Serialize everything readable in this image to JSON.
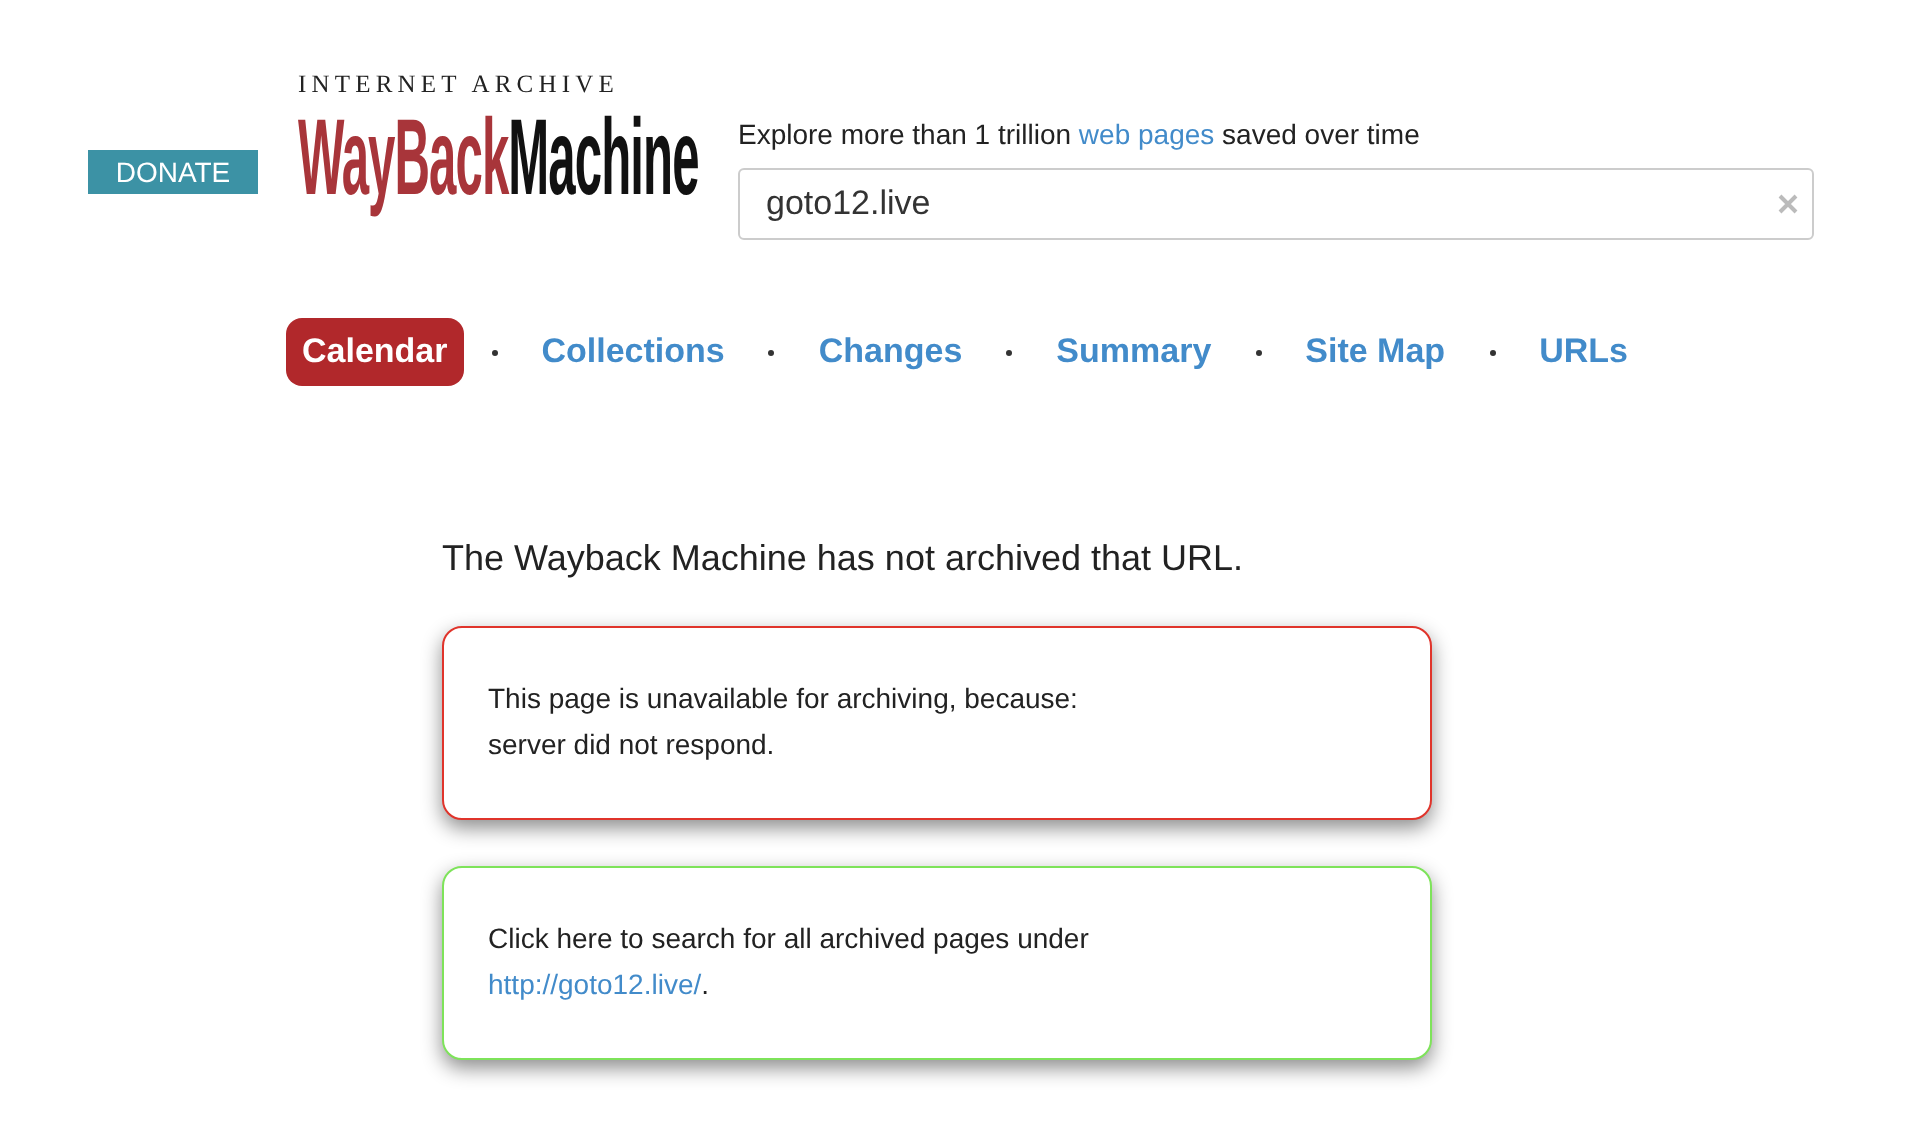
{
  "donate_button": "DONATE",
  "logo": {
    "top": "INTERNET ARCHIVE",
    "part_1": "WayBack",
    "part_2": "Machine"
  },
  "tagline": {
    "before": "Explore more than 1 trillion",
    "link": "web pages",
    "after": "saved over time"
  },
  "search": {
    "value": "goto12.live"
  },
  "tabs": [
    {
      "label": "Calendar",
      "selected": true
    },
    {
      "label": "Collections",
      "selected": false
    },
    {
      "label": "Changes",
      "selected": false
    },
    {
      "label": "Summary",
      "selected": false
    },
    {
      "label": "Site Map",
      "selected": false
    },
    {
      "label": "URLs",
      "selected": false
    }
  ],
  "heading": "The Wayback Machine has not archived that URL.",
  "messages": [
    {
      "kind": "error",
      "text": "This page is unavailable for archiving, because:",
      "detail": "server did not respond."
    },
    {
      "kind": "search",
      "text": "Click here to search for all archived pages under",
      "link": "http://goto12.live/",
      "after": "."
    }
  ]
}
